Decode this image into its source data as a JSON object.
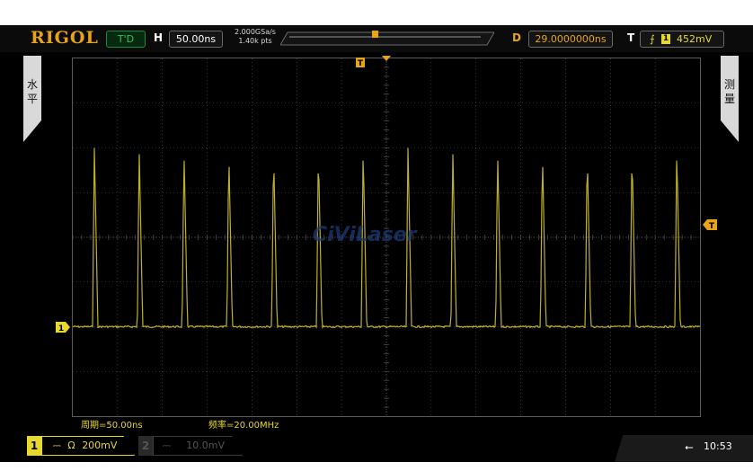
{
  "brand": "RIGOL",
  "status": "T'D",
  "horizontal": {
    "letter": "H",
    "timebase": "50.00ns"
  },
  "acquisition": {
    "sample_rate": "2.000GSa/s",
    "memory_depth": "1.40k pts"
  },
  "trigger_marker": "T",
  "delay": {
    "letter": "D",
    "value": "29.0000000ns"
  },
  "trigger": {
    "letter": "T",
    "source": "1",
    "level": "452mV"
  },
  "side_tabs": {
    "left": "水平",
    "right": "测量"
  },
  "watermark": "CiViLaser",
  "measurements": {
    "period": "周期=50.00ns",
    "frequency": "频率=20.00MHz"
  },
  "channels": [
    {
      "num": "1",
      "coupling": "⎓",
      "impedance": "Ω",
      "scale": "200mV"
    },
    {
      "num": "2",
      "coupling": "⎓",
      "scale": "10.0mV"
    }
  ],
  "channel1_marker": "1",
  "clock": "10:53",
  "colors": {
    "ch1": "#e8d82a",
    "trace": "#bfb02a",
    "accent": "#e8a317",
    "grid": "#5c5c5c"
  },
  "waveform": {
    "type": "pulse-train",
    "period_ns": 50,
    "frequency_mhz": 20,
    "pulse_count": 14,
    "baseline_div": -2.0,
    "peak_div": 2.0
  }
}
